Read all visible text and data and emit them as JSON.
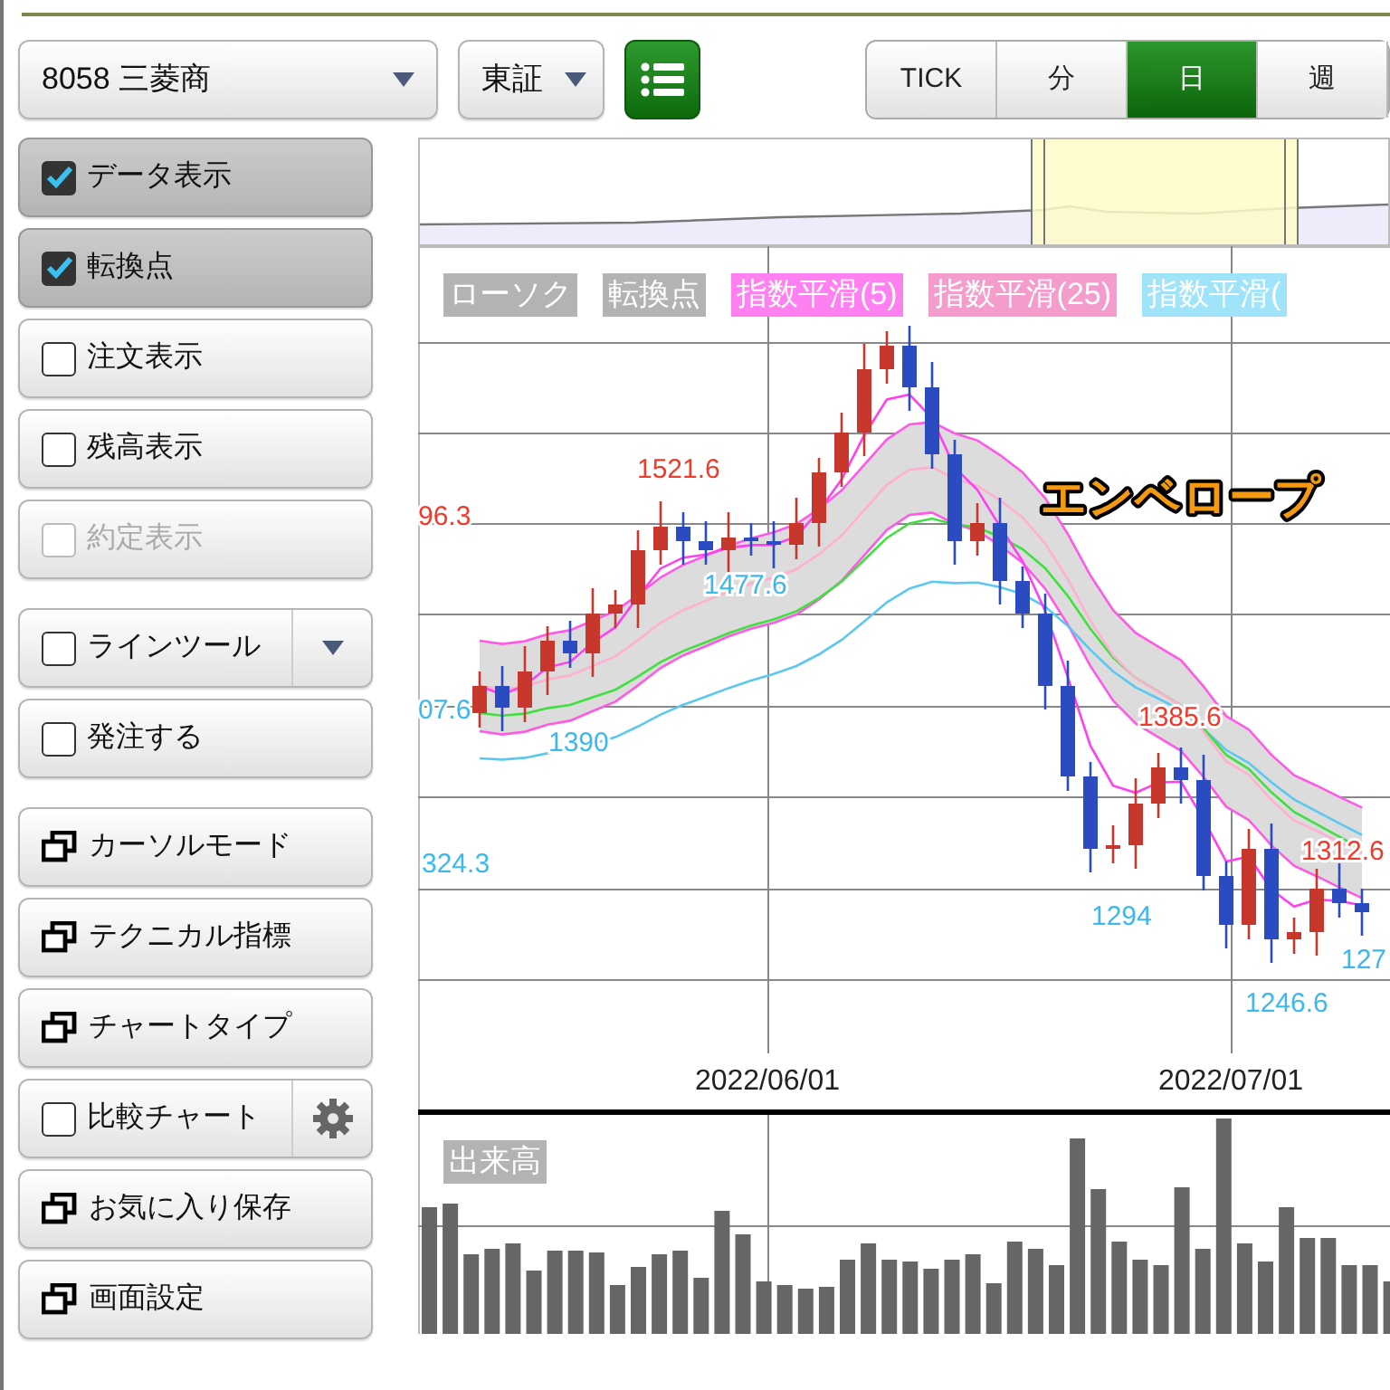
{
  "toolbar": {
    "symbol_select": {
      "value": "8058 三菱商"
    },
    "market_select": {
      "value": "東証"
    },
    "period_tabs": [
      {
        "label": "TICK",
        "selected": false
      },
      {
        "label": "分",
        "selected": false
      },
      {
        "label": "日",
        "selected": true
      },
      {
        "label": "週",
        "selected": false
      }
    ]
  },
  "sidebar": {
    "groups": [
      [
        {
          "kind": "checkbox",
          "label": "データ表示",
          "checked": true,
          "disabled": false
        },
        {
          "kind": "checkbox",
          "label": "転換点",
          "checked": true,
          "disabled": false
        },
        {
          "kind": "checkbox",
          "label": "注文表示",
          "checked": false,
          "disabled": false
        },
        {
          "kind": "checkbox",
          "label": "残高表示",
          "checked": false,
          "disabled": false
        },
        {
          "kind": "checkbox",
          "label": "約定表示",
          "checked": false,
          "disabled": true
        }
      ],
      [
        {
          "kind": "checkbox-dropdown",
          "label": "ラインツール",
          "checked": false,
          "disabled": false
        },
        {
          "kind": "checkbox",
          "label": "発注する",
          "checked": false,
          "disabled": false
        }
      ],
      [
        {
          "kind": "window",
          "label": "カーソルモード",
          "disabled": false
        },
        {
          "kind": "window",
          "label": "テクニカル指標",
          "disabled": false
        },
        {
          "kind": "window",
          "label": "チャートタイプ",
          "disabled": false
        },
        {
          "kind": "checkbox-settings",
          "label": "比較チャート",
          "checked": false,
          "disabled": false
        },
        {
          "kind": "window",
          "label": "お気に入り保存",
          "disabled": false
        },
        {
          "kind": "window",
          "label": "画面設定",
          "disabled": false
        }
      ]
    ]
  },
  "chart": {
    "legend": [
      {
        "label": "ローソク",
        "color": "#b3b3b3"
      },
      {
        "label": "転換点",
        "color": "#b3b3b3"
      },
      {
        "label": "指数平滑(5)",
        "color": "#ff80f0"
      },
      {
        "label": "指数平滑(25)",
        "color": "#f49ccc"
      },
      {
        "label": "指数平滑(",
        "color": "#a0e4fa"
      }
    ],
    "overlay_label": "エンベロープ",
    "price_labels": [
      {
        "text": "96.3",
        "kind": "high"
      },
      {
        "text": "1521.6",
        "kind": "high"
      },
      {
        "text": "1477.6",
        "kind": "low"
      },
      {
        "text": "07.6",
        "kind": "low"
      },
      {
        "text": "1390",
        "kind": "low"
      },
      {
        "text": "324.3",
        "kind": "low"
      },
      {
        "text": "1385.6",
        "kind": "high"
      },
      {
        "text": "1294",
        "kind": "low"
      },
      {
        "text": "1312.6",
        "kind": "high"
      },
      {
        "text": "1246.6",
        "kind": "low"
      },
      {
        "text": "127",
        "kind": "low"
      }
    ],
    "date_labels": [
      "2022/06/01",
      "2022/07/01"
    ],
    "volume_label": "出来高"
  }
}
